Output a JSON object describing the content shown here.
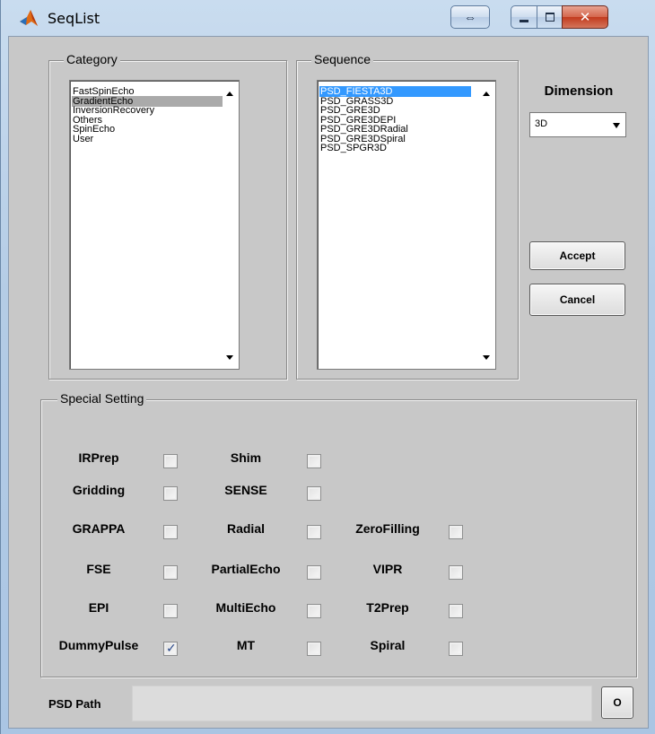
{
  "window": {
    "title": "SeqList"
  },
  "category": {
    "title": "Category",
    "items": [
      "FastSpinEcho",
      "GradientEcho",
      "InversionRecovery",
      "Others",
      "SpinEcho",
      "User"
    ],
    "selected": "GradientEcho"
  },
  "sequence": {
    "title": "Sequence",
    "items": [
      "PSD_FIESTA3D",
      "PSD_GRASS3D",
      "PSD_GRE3D",
      "PSD_GRE3DEPI",
      "PSD_GRE3DRadial",
      "PSD_GRE3DSpiral",
      "PSD_SPGR3D"
    ],
    "selected": "PSD_FIESTA3D"
  },
  "dimension": {
    "label": "Dimension",
    "value": "3D"
  },
  "buttons": {
    "accept": "Accept",
    "cancel": "Cancel",
    "browse": "O"
  },
  "special_setting": {
    "title": "Special Setting",
    "options": [
      {
        "label": "IRPrep",
        "checked": false
      },
      {
        "label": "Shim",
        "checked": false
      },
      {
        "label": "Gridding",
        "checked": false
      },
      {
        "label": "SENSE",
        "checked": false
      },
      {
        "label": "GRAPPA",
        "checked": false
      },
      {
        "label": "Radial",
        "checked": false
      },
      {
        "label": "ZeroFilling",
        "checked": false
      },
      {
        "label": "FSE",
        "checked": false
      },
      {
        "label": "PartialEcho",
        "checked": false
      },
      {
        "label": "VIPR",
        "checked": false
      },
      {
        "label": "EPI",
        "checked": false
      },
      {
        "label": "MultiEcho",
        "checked": false
      },
      {
        "label": "T2Prep",
        "checked": false
      },
      {
        "label": "DummyPulse",
        "checked": true
      },
      {
        "label": "MT",
        "checked": false
      },
      {
        "label": "Spiral",
        "checked": false
      }
    ]
  },
  "psd_path": {
    "label": "PSD Path",
    "value": ""
  },
  "colors": {
    "selection_blue": "#3399ff",
    "selection_grey": "#aaaaaa",
    "panel_bg": "#c8c8c8"
  }
}
